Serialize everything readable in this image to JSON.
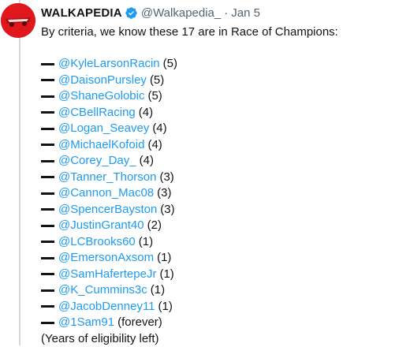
{
  "tweet": {
    "display_name": "WALKAPEDIA",
    "handle": "@Walkapedia_",
    "separator": "·",
    "date": "Jan 5",
    "intro": "By criteria, we know these 17 are in Race of Champions:",
    "footer": "(Years of eligibility left)",
    "accent_color": "#1d9bf0",
    "avatar_color": "#e0181e",
    "entries": [
      {
        "mention": "@KyleLarsonRacin",
        "count": "(5)"
      },
      {
        "mention": "@DaisonPursley",
        "count": "(5)"
      },
      {
        "mention": "@ShaneGolobic",
        "count": "(5)"
      },
      {
        "mention": "@CBellRacing",
        "count": "(4)"
      },
      {
        "mention": "@Logan_Seavey",
        "count": "(4)"
      },
      {
        "mention": "@MichaelKofoid",
        "count": "(4)"
      },
      {
        "mention": "@Corey_Day_",
        "count": "(4)"
      },
      {
        "mention": "@Tanner_Thorson",
        "count": "(3)"
      },
      {
        "mention": "@Cannon_Mac08",
        "count": "(3)"
      },
      {
        "mention": "@SpencerBayston",
        "count": "(3)"
      },
      {
        "mention": "@JustinGrant40",
        "count": "(2)"
      },
      {
        "mention": "@LCBrooks60",
        "count": "(1)"
      },
      {
        "mention": "@EmersonAxsom",
        "count": "(1)"
      },
      {
        "mention": "@SamHafertepeJr",
        "count": "(1)"
      },
      {
        "mention": "@K_Cummins3c",
        "count": "(1)"
      },
      {
        "mention": "@JacobDenney11",
        "count": "(1)"
      },
      {
        "mention": "@1Sam91",
        "count": "(forever)"
      }
    ]
  }
}
